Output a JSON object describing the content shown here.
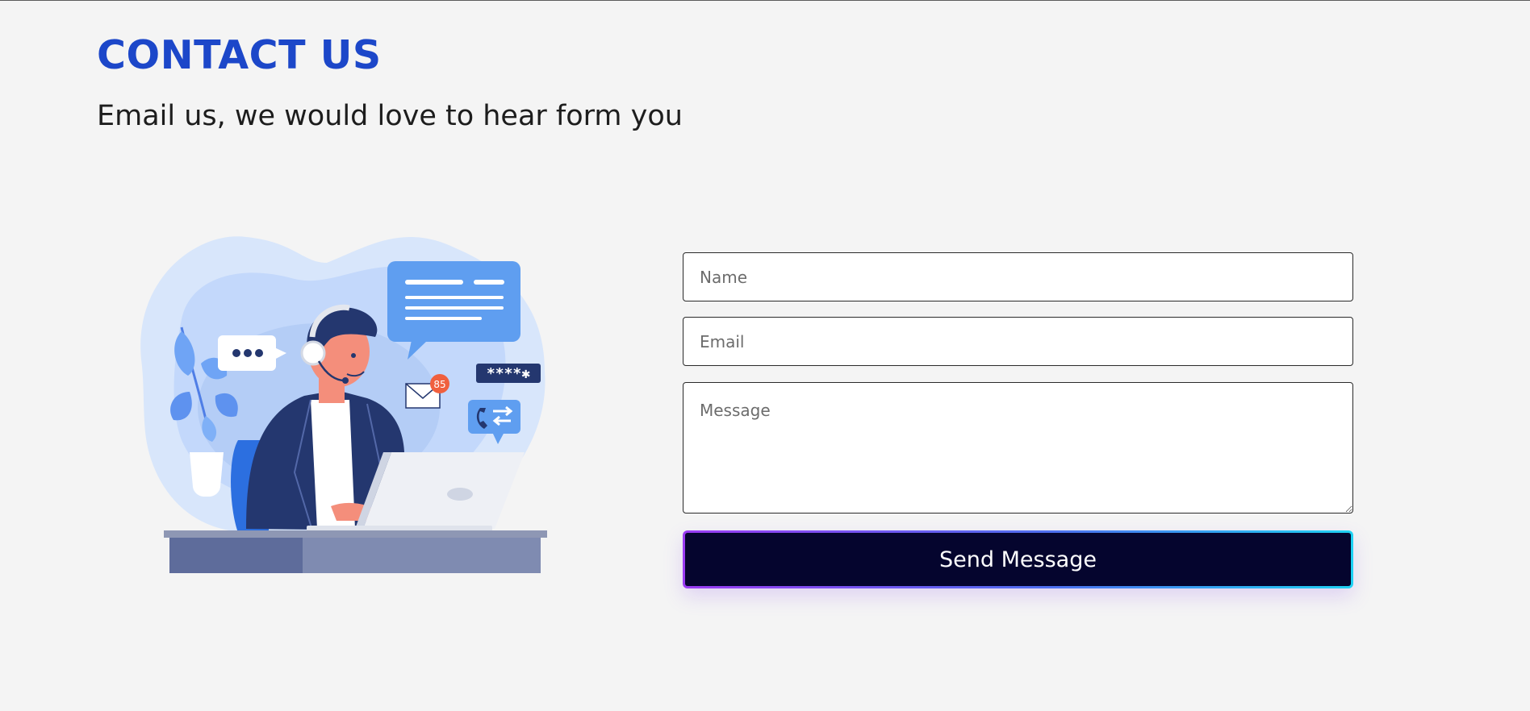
{
  "header": {
    "title": "CONTACT US",
    "subtitle": "Email us, we would love to hear form you"
  },
  "illustration": {
    "icon": "customer-support-illustration",
    "notification_count": "85",
    "password_mask": "****✱",
    "colors": {
      "blob_light": "#d8e6fb",
      "blob_mid": "#b9d2fb",
      "accent_blue": "#5f9ef0",
      "navy": "#24376f",
      "skin": "#f48e7b",
      "badge": "#f0603e"
    }
  },
  "form": {
    "name_placeholder": "Name",
    "email_placeholder": "Email",
    "message_placeholder": "Message",
    "submit_label": "Send Message"
  },
  "colors": {
    "title": "#1c47c9",
    "background": "#f4f4f4",
    "button_bg": "#05052e",
    "button_gradient_start": "#9b3cf2",
    "button_gradient_end": "#1fd2f3"
  }
}
